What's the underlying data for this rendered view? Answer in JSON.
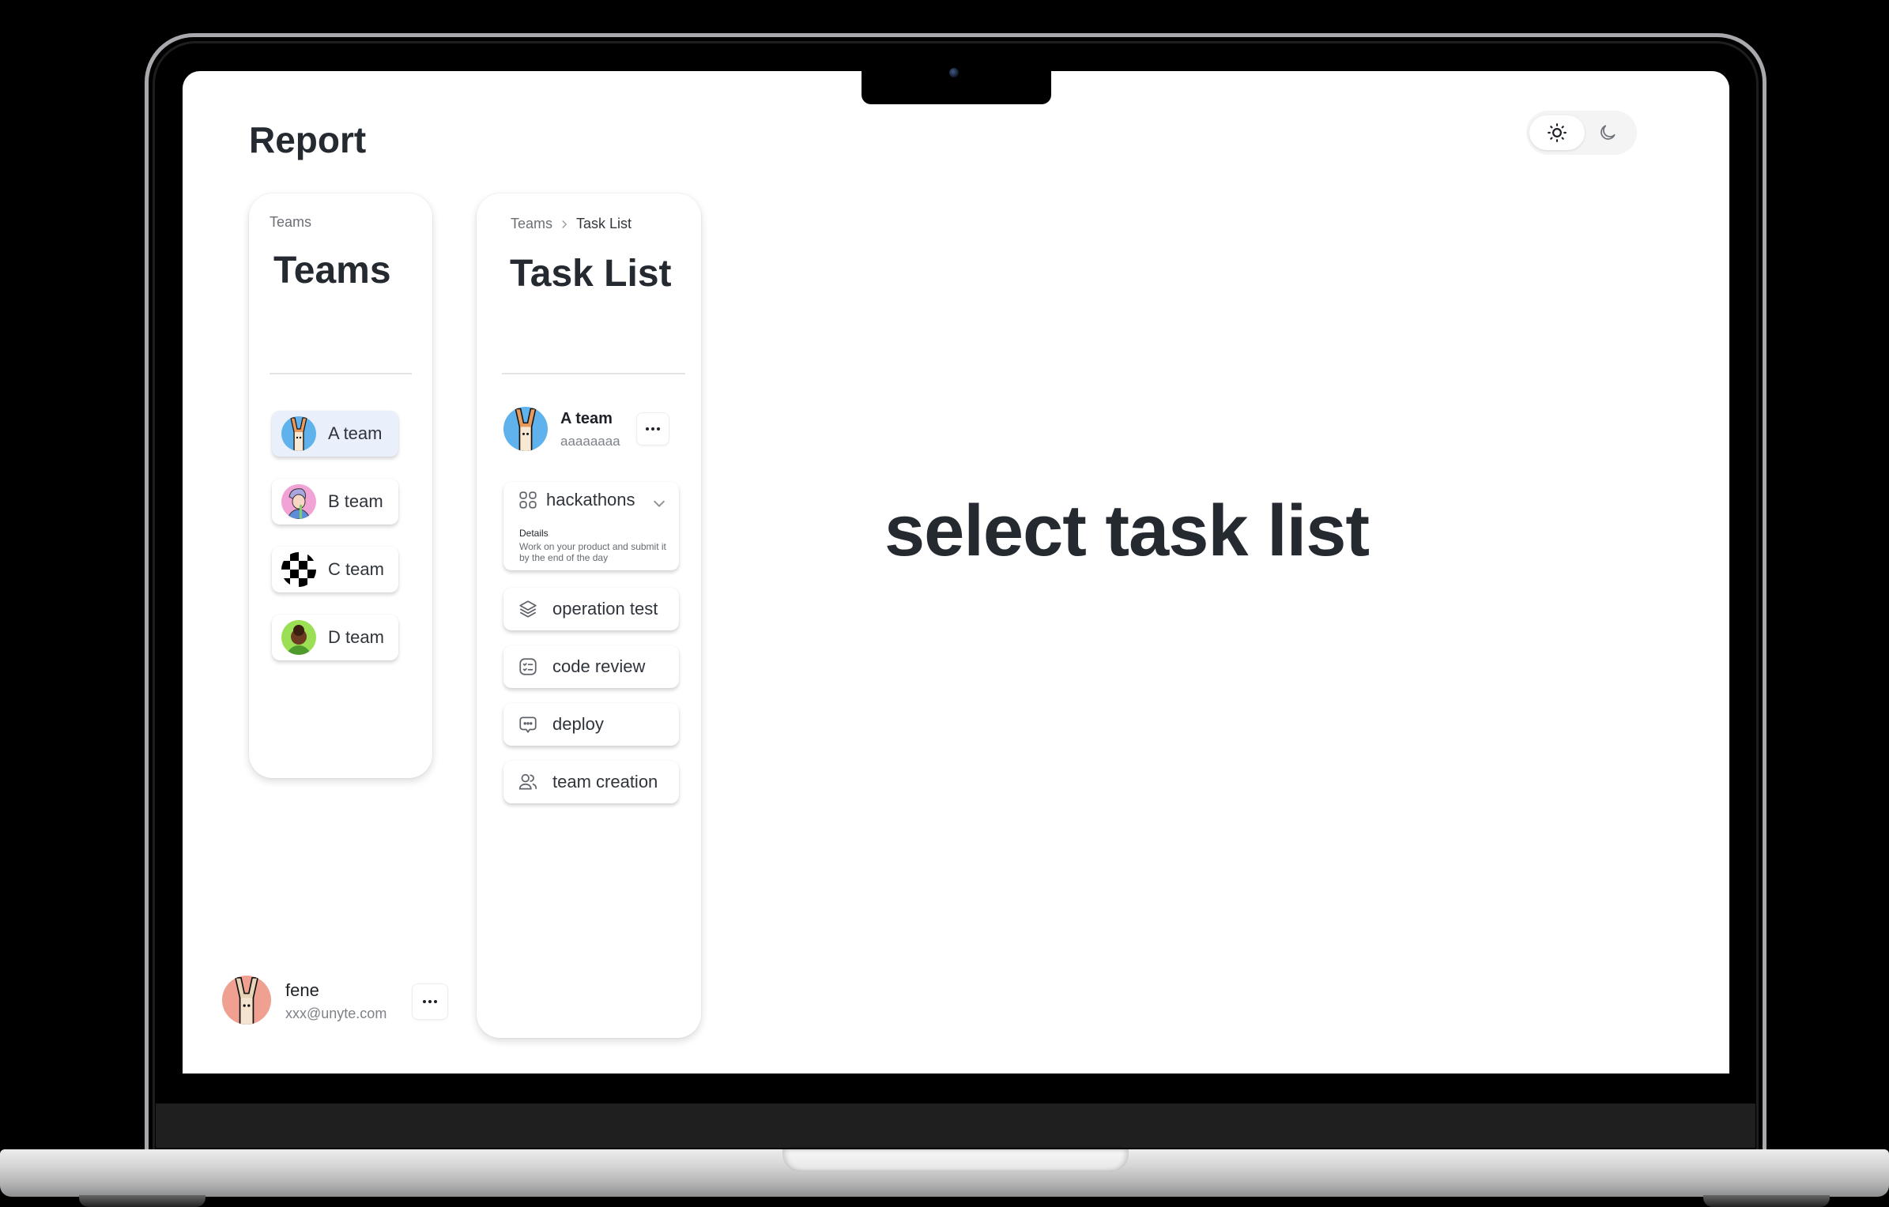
{
  "app": {
    "title": "Report",
    "theme_toggle": {
      "options": [
        "light",
        "dark"
      ],
      "selected": "light"
    }
  },
  "teams_panel": {
    "breadcrumb": "Teams",
    "title": "Teams",
    "items": [
      {
        "label": "A team",
        "avatar": "rabbit-avatar-blue",
        "active": true
      },
      {
        "label": "B team",
        "avatar": "person-avatar-pink",
        "active": false
      },
      {
        "label": "C team",
        "avatar": "checker-avatar",
        "active": false
      },
      {
        "label": "D team",
        "avatar": "person-avatar-green",
        "active": false
      }
    ]
  },
  "tasks_panel": {
    "breadcrumb": [
      "Teams",
      "Task List"
    ],
    "title": "Task List",
    "team": {
      "name": "A team",
      "subtitle": "aaaaaaaa"
    },
    "tasks": [
      {
        "label": "hackathons",
        "icon": "grid-icon",
        "expanded": true,
        "details_label": "Details",
        "details_text": "Work on your product and submit it by the end of the day"
      },
      {
        "label": "operation test",
        "icon": "layers-icon"
      },
      {
        "label": "code review",
        "icon": "checklist-icon"
      },
      {
        "label": "deploy",
        "icon": "chat-bubble-icon"
      },
      {
        "label": "team creation",
        "icon": "users-icon"
      }
    ]
  },
  "user": {
    "name": "fene",
    "email": "xxx@unyte.com"
  },
  "main": {
    "placeholder": "select task list"
  },
  "colors": {
    "text": "#252a31",
    "active_item_bg": "#eaf0fb",
    "muted": "#7d8188"
  }
}
